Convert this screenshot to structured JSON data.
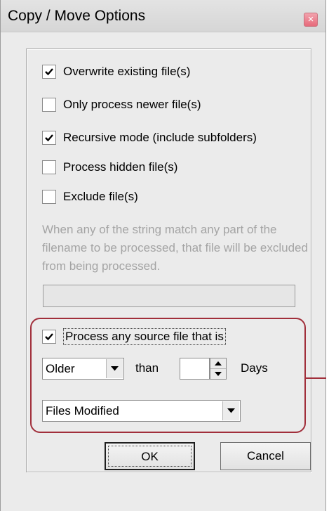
{
  "window": {
    "title": "Copy / Move Options",
    "close_glyph": "×"
  },
  "options": [
    {
      "label": "Overwrite existing file(s)",
      "checked": true
    },
    {
      "label": "Only process newer file(s)",
      "checked": false
    },
    {
      "label": "Recursive mode (include subfolders)",
      "checked": true
    },
    {
      "label": "Process hidden file(s)",
      "checked": false
    },
    {
      "label": "Exclude file(s)",
      "checked": false
    }
  ],
  "exclude": {
    "description": "When any of the string match any part of the filename to be processed, that file will be excluded from being processed.",
    "value": ""
  },
  "age_filter": {
    "label": "Process any source file that is",
    "checked": true,
    "comparison": "Older",
    "than_label": "than",
    "amount": "",
    "unit_label": "Days",
    "date_type": "Files Modified"
  },
  "buttons": {
    "ok": "OK",
    "cancel": "Cancel"
  },
  "colors": {
    "highlight": "#a12f3b",
    "close_button": "#e76a7b"
  }
}
